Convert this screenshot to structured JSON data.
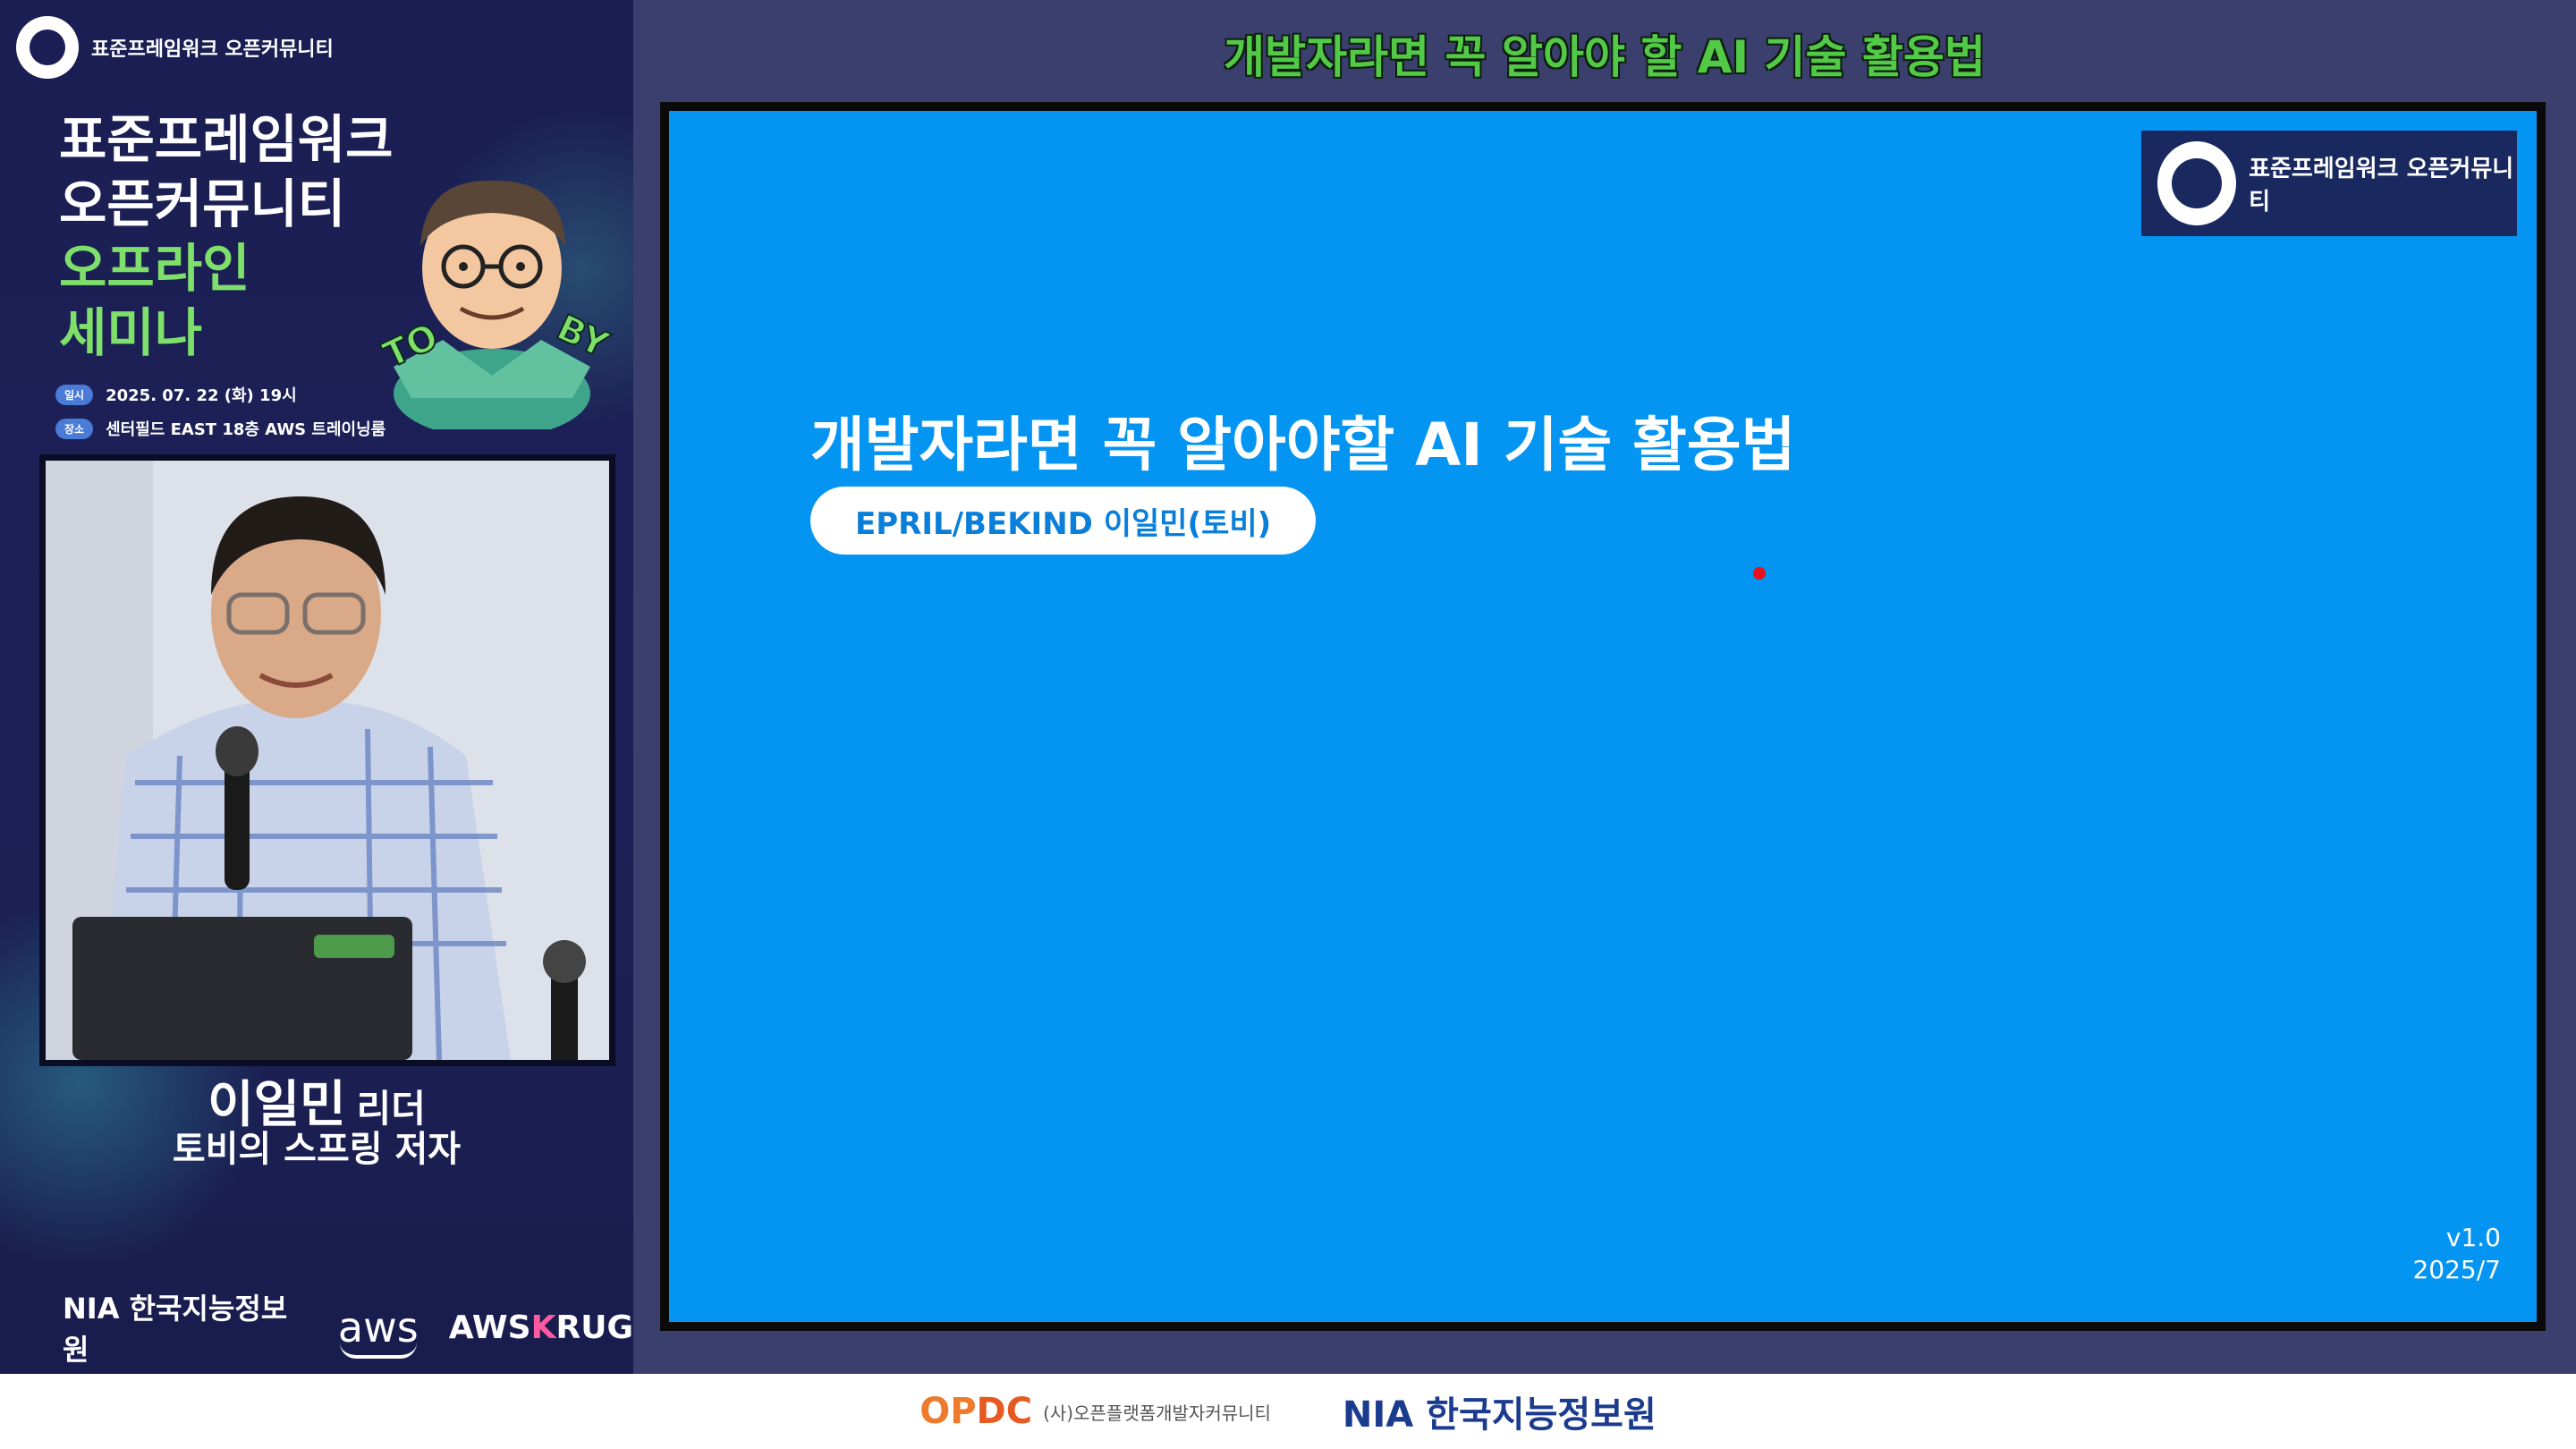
{
  "left_panel": {
    "brand": "표준프레임워크 오픈커뮤니티",
    "title_lines": [
      "표준프레임워크",
      "오픈커뮤니티"
    ],
    "title_green_lines": [
      "오프라인",
      "세미나"
    ],
    "date_tag": "일시",
    "date": "2025. 07. 22 (화) 19시",
    "place_tag": "장소",
    "place": "센터필드 EAST 18층 AWS 트레이닝룸",
    "speaker_name": "이일민",
    "speaker_title": "리더",
    "speaker_role": "토비의 스프링 저자",
    "sponsors": {
      "nia": "NIA 한국지능정보원",
      "aws": "aws",
      "awskrug_a": "AWS",
      "awskrug_k": "K",
      "awskrug_rug": "RUG"
    }
  },
  "top_heading": "개발자라면 꼭 알아야 할 AI 기술 활용법",
  "slide": {
    "logo_text": "표준프레임워크 오픈커뮤니티",
    "title": "개발자라면 꼭 알아야할 AI 기술 활용법",
    "author": "EPRIL/BEKIND 이일민(토비)",
    "version": "v1.0",
    "date": "2025/7"
  },
  "bottom_bar": {
    "opdc_mark_op": "OP",
    "opdc_mark_dc": "DC",
    "opdc_text": "(사)오픈플랫폼개발자커뮤니티",
    "nia": "NIA 한국지능정보원"
  },
  "colors": {
    "slide_bg": "#0494f1",
    "panel_bg": "#1a1e52",
    "heading_green": "#53c948",
    "accent_green": "#7ee06a"
  }
}
